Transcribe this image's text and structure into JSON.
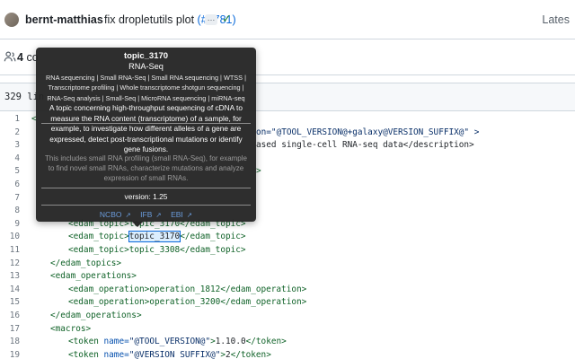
{
  "commit": {
    "author": "bernt-matthias",
    "message": "fix dropletutils plot",
    "pr_link": "(#3781)",
    "more_label": "…",
    "latest_label": "Lates"
  },
  "contributors": {
    "count": "4",
    "label": "co"
  },
  "file": {
    "lines_label": "329 lin"
  },
  "code": {
    "lines": [
      {
        "num": "1",
        "text": "<"
      },
      {
        "num": "2",
        "text": "on=\"@TOOL_VERSION@+galaxy@VERSION_SUFFIX@\" >"
      },
      {
        "num": "3",
        "text": "ased single-cell RNA-seq data</description>"
      },
      {
        "num": "4",
        "text": ""
      },
      {
        "num": "5",
        "text": ">"
      },
      {
        "num": "6",
        "text": ""
      },
      {
        "num": "7",
        "text": ""
      },
      {
        "num": "8",
        "text": ""
      },
      {
        "num": "9",
        "text": "<edam_topic>topic_3170</edam_topic>"
      },
      {
        "num": "10",
        "text_before": "<edam_topic>",
        "highlight": "topic_3170",
        "text_after": "</edam_topic>"
      },
      {
        "num": "11",
        "text": "<edam_topic>topic_3308</edam_topic>"
      },
      {
        "num": "12",
        "text": "</edam_topics>"
      },
      {
        "num": "13",
        "text": "<edam_operations>"
      },
      {
        "num": "14",
        "text": "<edam_operation>operation_1812</edam_operation>"
      },
      {
        "num": "15",
        "text": "<edam_operation>operation_3200</edam_operation>"
      },
      {
        "num": "16",
        "text": "</edam_operations>"
      },
      {
        "num": "17",
        "text": "<macros>"
      },
      {
        "num": "18",
        "token_name": "@TOOL_VERSION@",
        "token_value": "1.10.0"
      },
      {
        "num": "19",
        "token_name": "@VERSION_SUFFIX@",
        "token_value": "2"
      }
    ]
  },
  "tooltip": {
    "id": "topic_3170",
    "label": "RNA-Seq",
    "synonyms": "RNA sequencing | Small RNA-Seq | Small RNA sequencing | WTSS | Transcriptome profiling | Whole transcriptome shotgun sequencing | RNA-Seq analysis | Small-Seq | MicroRNA sequencing | miRNA-seq",
    "definition": "A topic concerning high-throughput sequencing of cDNA to measure the RNA content (transcriptome) of a sample, for example, to investigate how different alleles of a gene are expressed, detect post-transcriptional mutations or identify gene fusions.",
    "comment": "This includes small RNA profiling (small RNA-Seq), for example to find novel small RNAs, characterize mutations and analyze expression of small RNAs.",
    "version": "version: 1.25",
    "links": {
      "ncbo": "NCBO",
      "ifb": "IFB",
      "ebi": "EBI"
    }
  }
}
